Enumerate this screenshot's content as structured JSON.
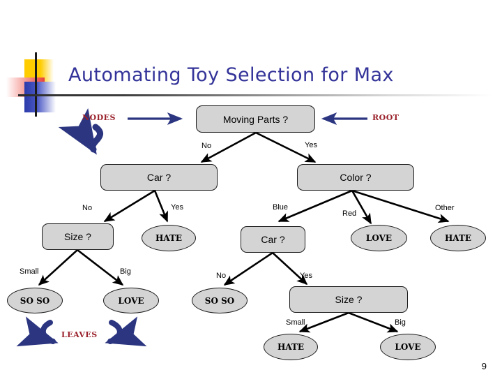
{
  "slide": {
    "title": "Automating Toy Selection for Max",
    "page_number": "9",
    "title_color": "#333399",
    "annotation_color": "#99202A",
    "node_fill": "#D4D4D4",
    "arrow_color": "#2B3580"
  },
  "annotations": [
    {
      "id": "nodes",
      "label": "NODES"
    },
    {
      "id": "root",
      "label": "ROOT"
    },
    {
      "id": "leaves",
      "label": "LEAVES"
    }
  ],
  "tree": {
    "nodes": [
      {
        "id": "moving-parts",
        "label": "Moving Parts ?",
        "kind": "internal"
      },
      {
        "id": "car-left",
        "label": "Car ?",
        "kind": "internal"
      },
      {
        "id": "color",
        "label": "Color ?",
        "kind": "internal"
      },
      {
        "id": "size-left",
        "label": "Size ?",
        "kind": "internal"
      },
      {
        "id": "hate-1",
        "label": "HATE",
        "kind": "leaf"
      },
      {
        "id": "car-right",
        "label": "Car ?",
        "kind": "internal"
      },
      {
        "id": "love-1",
        "label": "LOVE",
        "kind": "leaf"
      },
      {
        "id": "hate-2",
        "label": "HATE",
        "kind": "leaf"
      },
      {
        "id": "soso-1",
        "label": "SO SO",
        "kind": "leaf"
      },
      {
        "id": "love-2",
        "label": "LOVE",
        "kind": "leaf"
      },
      {
        "id": "soso-2",
        "label": "SO SO",
        "kind": "leaf"
      },
      {
        "id": "size-right",
        "label": "Size ?",
        "kind": "internal"
      },
      {
        "id": "hate-3",
        "label": "HATE",
        "kind": "leaf"
      },
      {
        "id": "love-3",
        "label": "LOVE",
        "kind": "leaf"
      }
    ],
    "edges": [
      {
        "from": "moving-parts",
        "to": "car-left",
        "label": "No"
      },
      {
        "from": "moving-parts",
        "to": "color",
        "label": "Yes"
      },
      {
        "from": "car-left",
        "to": "size-left",
        "label": "No"
      },
      {
        "from": "car-left",
        "to": "hate-1",
        "label": "Yes"
      },
      {
        "from": "color",
        "to": "car-right",
        "label": "Blue"
      },
      {
        "from": "color",
        "to": "love-1",
        "label": "Red"
      },
      {
        "from": "color",
        "to": "hate-2",
        "label": "Other"
      },
      {
        "from": "size-left",
        "to": "soso-1",
        "label": "Small"
      },
      {
        "from": "size-left",
        "to": "love-2",
        "label": "Big"
      },
      {
        "from": "car-right",
        "to": "soso-2",
        "label": "No"
      },
      {
        "from": "car-right",
        "to": "size-right",
        "label": "Yes"
      },
      {
        "from": "size-right",
        "to": "hate-3",
        "label": "Small"
      },
      {
        "from": "size-right",
        "to": "love-3",
        "label": "Big"
      }
    ]
  }
}
